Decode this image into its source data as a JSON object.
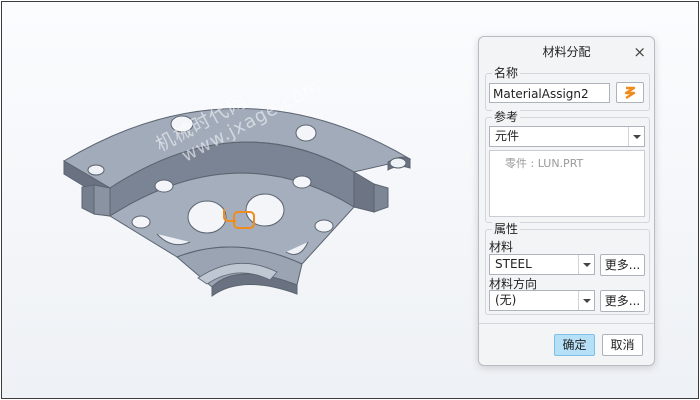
{
  "watermark": {
    "line1": "机械时代网",
    "line2": "www.jxage.com"
  },
  "dialog": {
    "title": "材料分配",
    "close_glyph": "×",
    "name_group": {
      "label": "名称",
      "value": "MaterialAssign2",
      "icon": "sketch-icon"
    },
    "ref_group": {
      "label": "参考",
      "type_value": "元件",
      "item": "零件 : LUN.PRT"
    },
    "prop_group": {
      "label": "属性",
      "material_label": "材料",
      "material_value": "STEEL",
      "material_more": "更多...",
      "direction_label": "材料方向",
      "direction_value": "(无)",
      "direction_more": "更多..."
    },
    "ok_label": "确定",
    "cancel_label": "取消"
  }
}
